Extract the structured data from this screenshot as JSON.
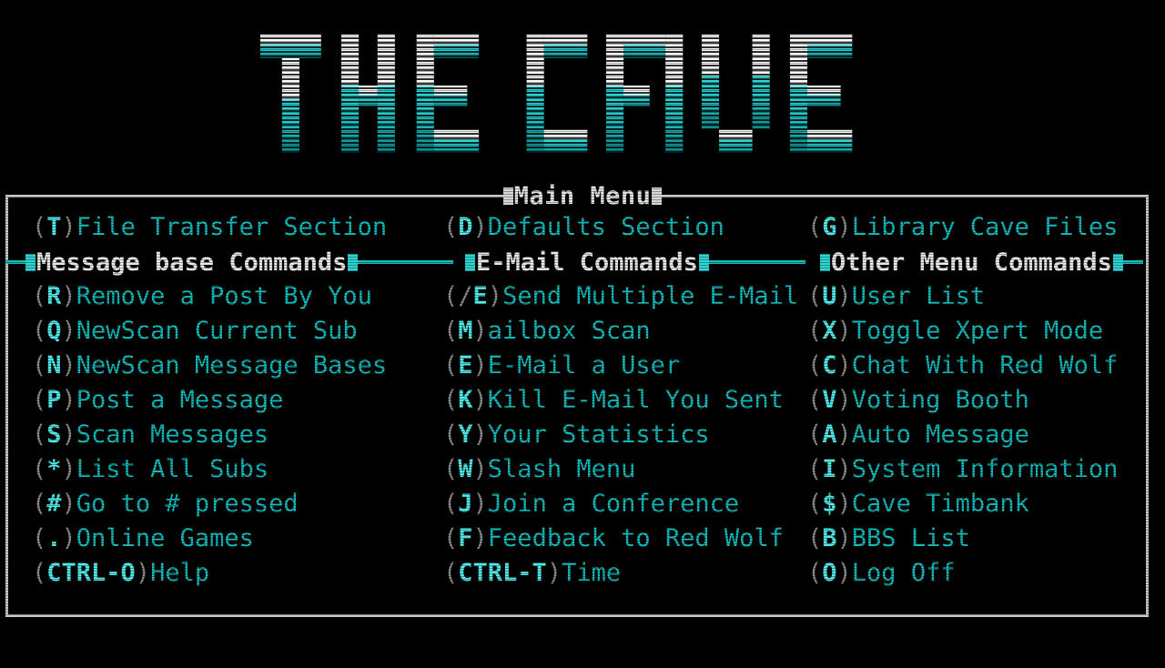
{
  "banner": {
    "text": "THE CAVE",
    "gradient_top": "#ffffff",
    "gradient_mid": "#2ad8d8",
    "gradient_bottom": "#0a8a8a"
  },
  "menu_box": {
    "title": "Main Menu",
    "title_marker": "■",
    "border_color": "#c8c8c8"
  },
  "colors": {
    "accent_cyan": "#12bdbd",
    "hotkey_cyan": "#4fe9e9",
    "paren_gray": "#8d8d8d",
    "header_white": "#e9e9e9",
    "section_line": "#17b9b9",
    "background": "#000000"
  },
  "top_row": [
    {
      "key": "T",
      "label": "File Transfer Section"
    },
    {
      "key": "D",
      "label": "Defaults Section"
    },
    {
      "key": "G",
      "label": "Library Cave Files"
    }
  ],
  "section_headers": [
    {
      "title": "Message base Commands"
    },
    {
      "title": "E-Mail Commands"
    },
    {
      "title": "Other Menu Commands"
    }
  ],
  "columns": {
    "message_base": [
      {
        "key": "R",
        "label": "Remove a Post By You"
      },
      {
        "key": "Q",
        "label": "NewScan Current Sub"
      },
      {
        "key": "N",
        "label": "NewScan Message Bases"
      },
      {
        "key": "P",
        "label": "Post a Message"
      },
      {
        "key": "S",
        "label": "Scan Messages"
      },
      {
        "key": "*",
        "label": "List All Subs"
      },
      {
        "key": "#",
        "label": "Go to # pressed"
      },
      {
        "key": ".",
        "label": "Online Games"
      },
      {
        "key": "CTRL-O",
        "label": "Help"
      }
    ],
    "email": [
      {
        "key": "/E",
        "label": "Send Multiple E-Mail"
      },
      {
        "key": "M",
        "label": "ailbox Scan"
      },
      {
        "key": "E",
        "label": "E-Mail a User"
      },
      {
        "key": "K",
        "label": "Kill E-Mail You Sent"
      },
      {
        "key": "Y",
        "label": "Your Statistics"
      },
      {
        "key": "W",
        "label": "Slash Menu"
      },
      {
        "key": "J",
        "label": "Join a Conference"
      },
      {
        "key": "F",
        "label": "Feedback to Red Wolf"
      },
      {
        "key": "CTRL-T",
        "label": "Time"
      }
    ],
    "other": [
      {
        "key": "U",
        "label": "User List"
      },
      {
        "key": "X",
        "label": "Toggle Xpert Mode"
      },
      {
        "key": "C",
        "label": "Chat With Red Wolf"
      },
      {
        "key": "V",
        "label": "Voting Booth"
      },
      {
        "key": "A",
        "label": "Auto Message"
      },
      {
        "key": "I",
        "label": "System Information"
      },
      {
        "key": "$",
        "label": "Cave Timbank"
      },
      {
        "key": "B",
        "label": "BBS List"
      },
      {
        "key": "O",
        "label": "Log Off"
      }
    ]
  }
}
